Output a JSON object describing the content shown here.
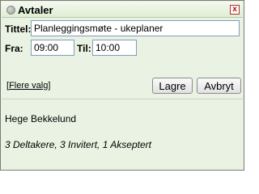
{
  "window": {
    "title": "Avtaler",
    "close_label": "x"
  },
  "form": {
    "title_label": "Tittel:",
    "title_value": "Planleggingsmøte - ukeplaner",
    "from_label": "Fra:",
    "from_value": "09:00",
    "to_label": "Til:",
    "to_value": "10:00",
    "more_open": "[",
    "more_link": "Flere valg",
    "more_close": "]",
    "save_label": "Lagre",
    "cancel_label": "Avbryt"
  },
  "info": {
    "organizer": "Hege Bekkelund",
    "participants": "3 Deltakere, 3 Invitert, 1 Akseptert"
  }
}
